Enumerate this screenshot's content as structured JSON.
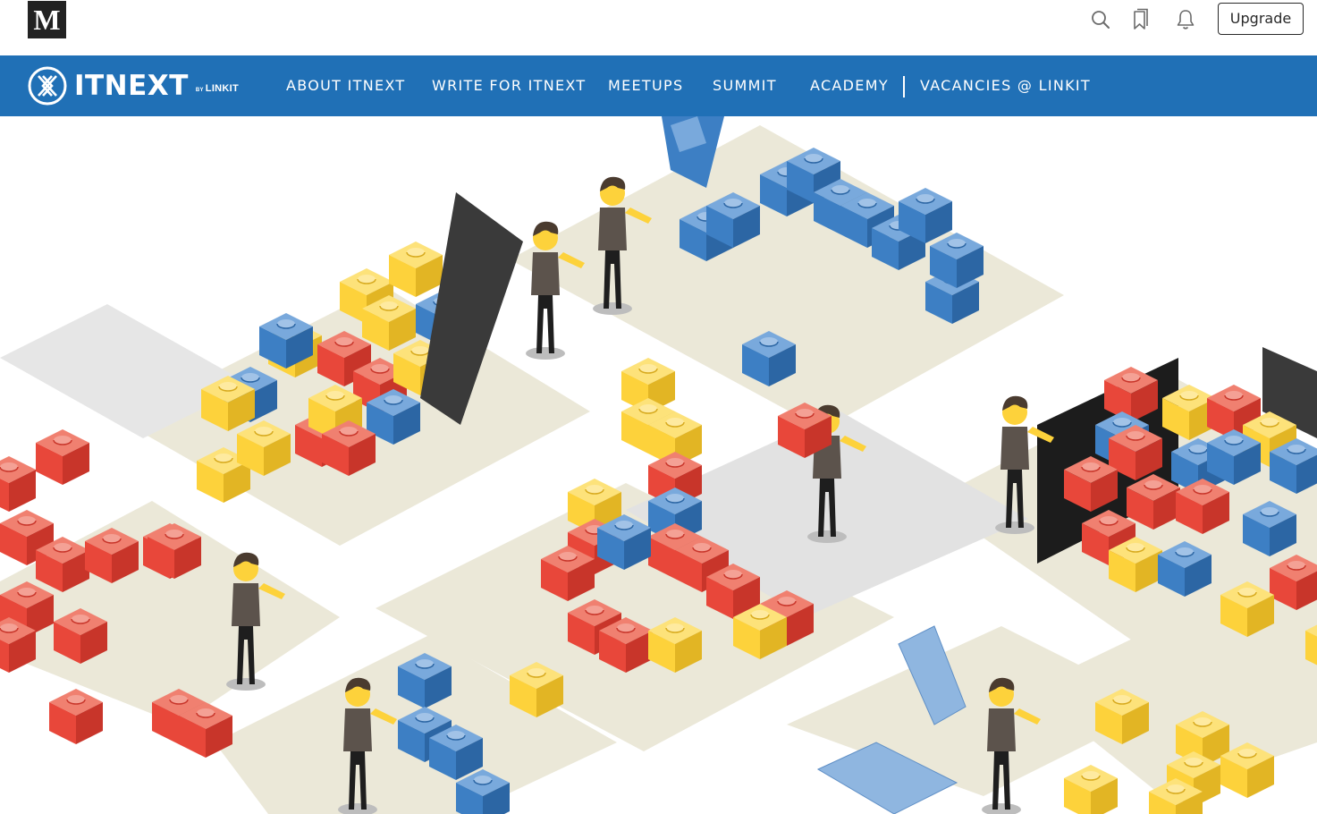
{
  "topbar": {
    "logo_letter": "M",
    "icons": [
      "search-icon",
      "bookmarks-icon",
      "notifications-bell-icon"
    ],
    "upgrade_label": "Upgrade"
  },
  "publication": {
    "logo_word": "ITNEXT",
    "logo_by_prefix": "BY",
    "logo_by_name": "LINKIT",
    "brand_color": "#2070b6",
    "nav": [
      {
        "label": "ABOUT ITNEXT"
      },
      {
        "label": "WRITE FOR ITNEXT"
      },
      {
        "label": "MEETUPS"
      },
      {
        "label": "SUMMIT"
      },
      {
        "label": "ACADEMY"
      },
      {
        "label": "VACANCIES @ LINKIT"
      }
    ]
  },
  "hero": {
    "palette": {
      "red": "#e8473a",
      "yellow": "#fdd23b",
      "blue": "#3d7fc4",
      "floor": "#ebe8d8",
      "shadow": "#c9c9c9",
      "shirt": "#5c534c",
      "skin": "#fdd23b"
    }
  }
}
